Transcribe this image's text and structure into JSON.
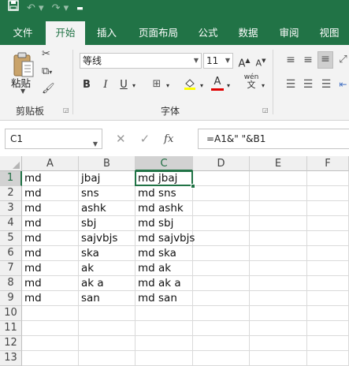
{
  "qat": {
    "save_icon": "save-icon",
    "undo_icon": "undo-icon",
    "redo_icon": "redo-icon",
    "customize_icon": "customize-icon"
  },
  "tabs": [
    {
      "label": "文件"
    },
    {
      "label": "开始"
    },
    {
      "label": "插入"
    },
    {
      "label": "页面布局"
    },
    {
      "label": "公式"
    },
    {
      "label": "数据"
    },
    {
      "label": "审阅"
    },
    {
      "label": "视图"
    }
  ],
  "active_tab": "开始",
  "ribbon": {
    "clipboard": {
      "paste_label": "粘贴",
      "group_label": "剪贴板"
    },
    "font": {
      "family": "等线",
      "size": "11",
      "bold": "B",
      "italic": "I",
      "underline": "U",
      "grow": "A",
      "shrink": "A",
      "wen": "wén",
      "font_color_char": "A",
      "group_label": "字体"
    }
  },
  "formula_bar": {
    "name_box": "C1",
    "formula": "=A1&\" \"&B1",
    "fx": "fx"
  },
  "grid": {
    "columns": [
      "A",
      "B",
      "C",
      "D",
      "E",
      "F"
    ],
    "rows": [
      "1",
      "2",
      "3",
      "4",
      "5",
      "6",
      "7",
      "8",
      "9",
      "10",
      "11",
      "12",
      "13"
    ],
    "active_cell": "C1",
    "cells": [
      [
        "md",
        "jbaj",
        "md jbaj"
      ],
      [
        "md",
        "sns",
        "md sns"
      ],
      [
        "md",
        "ashk",
        "md ashk"
      ],
      [
        "md",
        "sbj",
        "md sbj"
      ],
      [
        "md",
        "sajvbjs",
        "md sajvbjs"
      ],
      [
        "md",
        "ska",
        "md ska"
      ],
      [
        "md",
        "ak",
        "md ak"
      ],
      [
        "md",
        "ak a",
        "md ak a"
      ],
      [
        "md",
        "san",
        "md san"
      ]
    ]
  },
  "colors": {
    "accent": "#217346",
    "header_bg": "#f0f0f0",
    "selected_header_bg": "#d2d2d2"
  }
}
